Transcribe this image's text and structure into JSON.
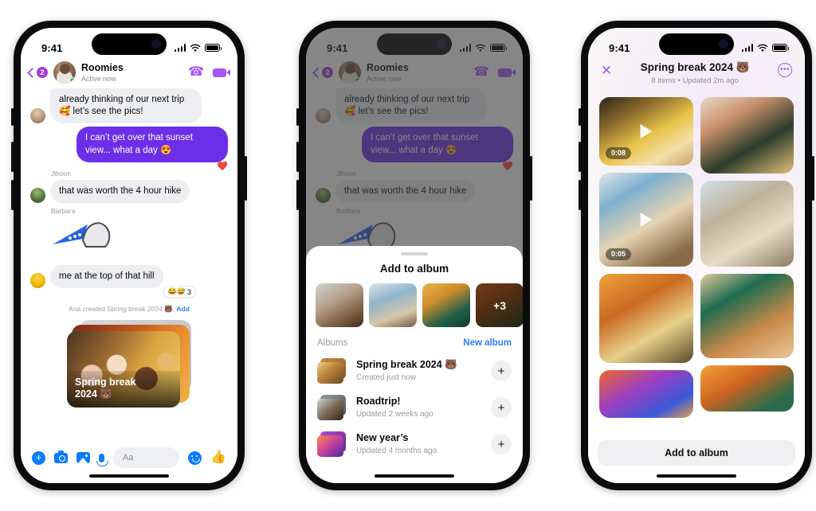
{
  "phone1": {
    "status": {
      "time": "9:41",
      "signal_icon": "cellular-bars-icon",
      "wifi_icon": "wifi-icon",
      "battery_icon": "battery-icon"
    },
    "header": {
      "back_icon": "back-chevron-icon",
      "unread_badge": "2",
      "avatar": "group-avatar",
      "name": "Roomies",
      "status": "Active now",
      "call_icon": "phone-call-icon",
      "video_icon": "video-call-icon"
    },
    "messages": [
      {
        "text": "already thinking of our next trip 🥰 let’s see the pics!",
        "side": "left",
        "sender": ""
      },
      {
        "text": "I can’t get over that sunset view... what a day 😍",
        "side": "right",
        "reaction": "❤️"
      },
      {
        "sender": "Jihoon",
        "text": "that was worth the 4 hour hike",
        "side": "left"
      },
      {
        "sender": "Barbara",
        "text": "",
        "side": "left",
        "sticker": "paper-plane-sticker"
      },
      {
        "text": "me at the top of that hill",
        "side": "left",
        "reaction_pill": "😂😅",
        "reaction_count": "3"
      }
    ],
    "system_line": {
      "text": "Ana created Spring break 2024 🐻.",
      "action": "Add"
    },
    "album_card": {
      "title_line1": "Spring break",
      "title_line2": "2024 🐻"
    },
    "composer": {
      "plus_icon": "plus-icon",
      "camera_icon": "camera-icon",
      "gallery_icon": "gallery-icon",
      "mic_icon": "microphone-icon",
      "placeholder": "Aa",
      "emoji_icon": "emoji-icon",
      "like_icon": "thumbs-up-icon"
    }
  },
  "phone2": {
    "status": {
      "time": "9:41"
    },
    "header": {
      "unread_badge": "2",
      "name": "Roomies",
      "status": "Active now"
    },
    "messages": [
      {
        "text": "already thinking of our next trip 🥰 let’s see the pics!"
      },
      {
        "text": "I can’t get over that sunset view... what a day 😍",
        "reaction": "❤️"
      },
      {
        "sender": "Jihoon",
        "text": "that was worth the 4 hour hike"
      },
      {
        "sender": "Barbara"
      }
    ],
    "sheet": {
      "title": "Add to album",
      "thumbs": [
        {
          "name": "selected-photo-1"
        },
        {
          "name": "selected-photo-2"
        },
        {
          "name": "selected-photo-3"
        },
        {
          "name": "selected-photo-4",
          "overflow_label": "+3"
        }
      ],
      "albums_label": "Albums",
      "new_album_label": "New album",
      "albums": [
        {
          "name": "Spring break 2024 🐻",
          "sub": "Created just now",
          "add_label": "+"
        },
        {
          "name": "Roadtrip!",
          "sub": "Updated 2 weeks ago",
          "add_label": "+"
        },
        {
          "name": "New year’s",
          "sub": "Updated 4 months ago",
          "add_label": "+"
        }
      ]
    }
  },
  "phone3": {
    "status": {
      "time": "9:41"
    },
    "header": {
      "close_icon": "close-icon",
      "title": "Spring break 2024 🐻",
      "subtitle": "8 items • Updated 2m ago",
      "more_icon": "more-options-icon",
      "more_label": "•••"
    },
    "grid": [
      {
        "id": "item-1",
        "type": "video",
        "duration": "0:08"
      },
      {
        "id": "item-2",
        "type": "photo"
      },
      {
        "id": "item-3",
        "type": "video",
        "duration": "0:05"
      },
      {
        "id": "item-4",
        "type": "photo"
      },
      {
        "id": "item-5",
        "type": "photo"
      },
      {
        "id": "item-6",
        "type": "photo"
      },
      {
        "id": "item-7",
        "type": "photo"
      },
      {
        "id": "item-8",
        "type": "photo"
      }
    ],
    "footer": {
      "button_label": "Add to album"
    }
  },
  "colors": {
    "messenger_purple": "#6c2fe8",
    "accent_purple": "#a855f7",
    "link_blue": "#2e7cf6",
    "composer_blue": "#0a7cff",
    "badge_purple": "#a33bdb",
    "online_green": "#31c04b"
  }
}
